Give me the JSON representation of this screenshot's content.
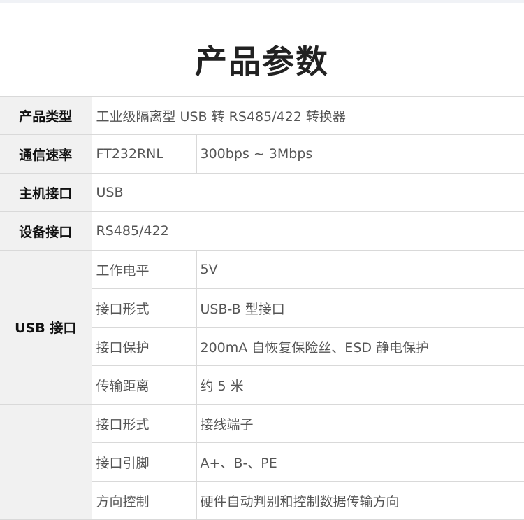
{
  "title": "产品参数",
  "rows": {
    "product_type": {
      "label": "产品类型",
      "value": "工业级隔离型 USB 转 RS485/422 转换器"
    },
    "comm_rate": {
      "label": "通信速率",
      "chip": "FT232RNL",
      "value": "300bps ~ 3Mbps"
    },
    "host_interface": {
      "label": "主机接口",
      "value": "USB"
    },
    "device_interface": {
      "label": "设备接口",
      "value": "RS485/422"
    }
  },
  "usb_group": {
    "label": "USB 接口",
    "items": [
      {
        "name": "工作电平",
        "value": "5V"
      },
      {
        "name": "接口形式",
        "value": "USB-B 型接口"
      },
      {
        "name": "接口保护",
        "value": "200mA 自恢复保险丝、ESD 静电保护"
      },
      {
        "name": "传输距离",
        "value": "约 5 米"
      }
    ]
  },
  "rs_group": {
    "label": "",
    "items": [
      {
        "name": "接口形式",
        "value": "接线端子"
      },
      {
        "name": "接口引脚",
        "value": "A+、B-、PE"
      },
      {
        "name": "方向控制",
        "value": "硬件自动判别和控制数据传输方向"
      }
    ]
  }
}
